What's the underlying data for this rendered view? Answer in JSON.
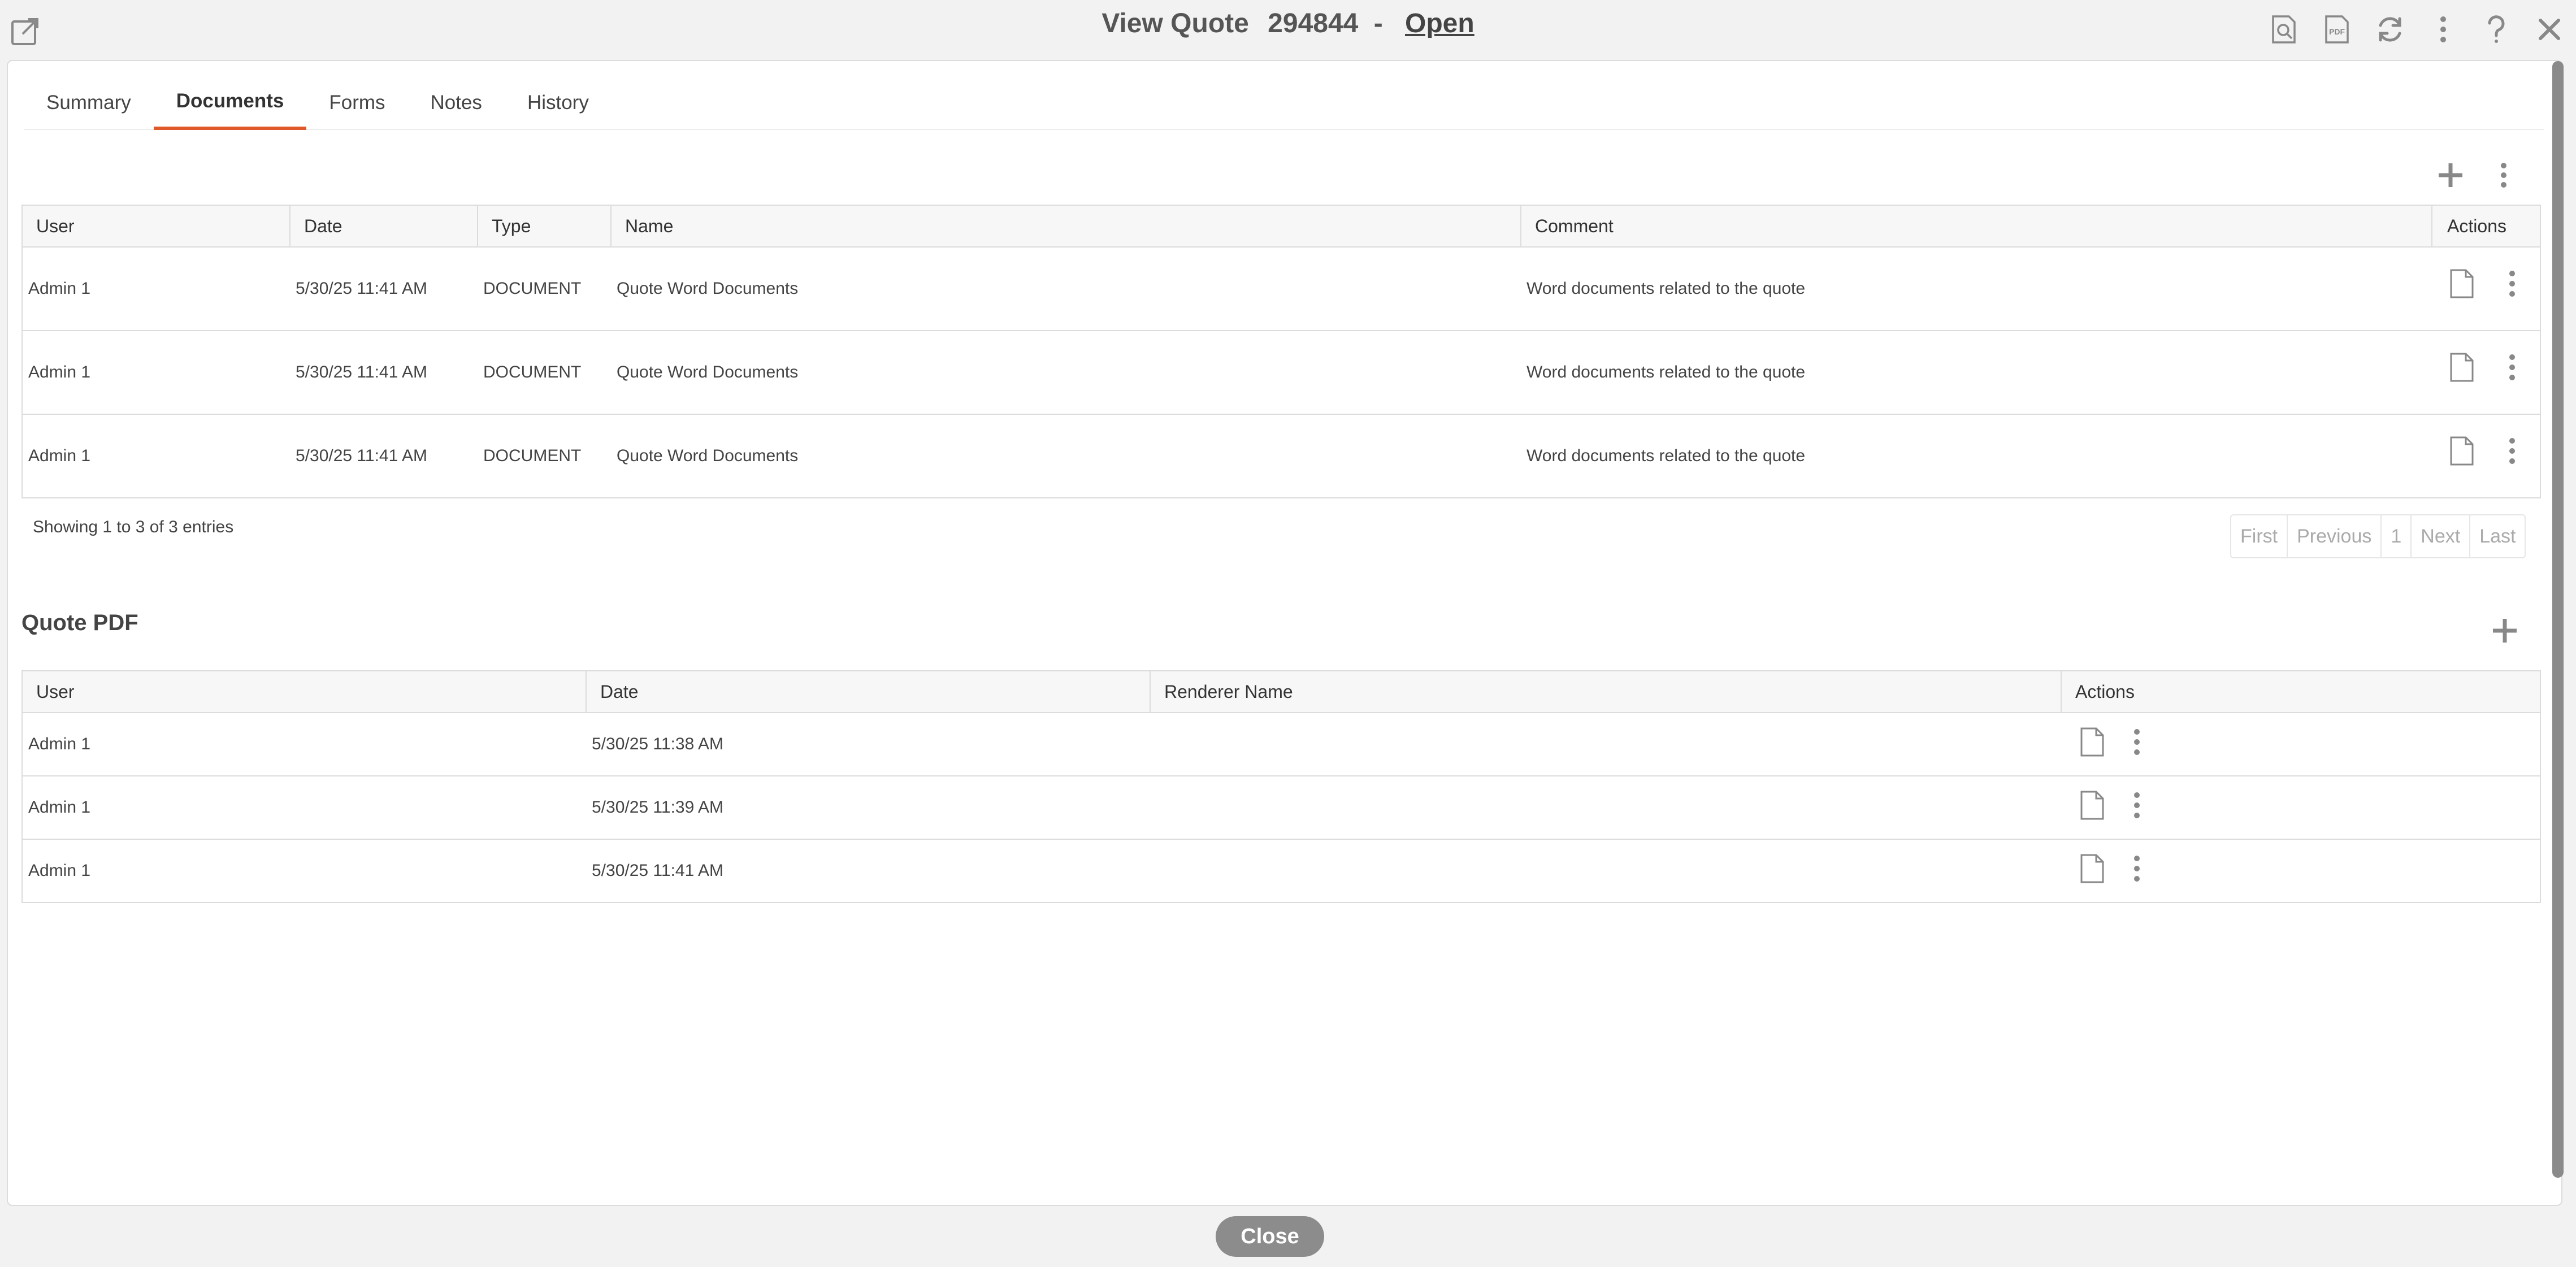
{
  "window": {
    "title_prefix": "View Quote",
    "quote_number": "294844",
    "separator": "-",
    "status": "Open"
  },
  "top_icons": [
    "preview-icon",
    "pdf-icon",
    "refresh-icon",
    "more-vertical-icon",
    "help-icon",
    "close-icon"
  ],
  "pdf_icon_text": "PDF",
  "tabs": [
    {
      "label": "Summary"
    },
    {
      "label": "Documents",
      "active": true
    },
    {
      "label": "Forms"
    },
    {
      "label": "Notes"
    },
    {
      "label": "History"
    }
  ],
  "documents_table": {
    "columns": [
      "User",
      "Date",
      "Type",
      "Name",
      "Comment",
      "Actions"
    ],
    "rows": [
      {
        "user": "Admin 1",
        "date": "5/30/25 11:41 AM",
        "type": "DOCUMENT",
        "name": "Quote Word Documents",
        "comment": "Word documents related to the quote"
      },
      {
        "user": "Admin 1",
        "date": "5/30/25 11:41 AM",
        "type": "DOCUMENT",
        "name": "Quote Word Documents",
        "comment": "Word documents related to the quote"
      },
      {
        "user": "Admin 1",
        "date": "5/30/25 11:41 AM",
        "type": "DOCUMENT",
        "name": "Quote Word Documents",
        "comment": "Word documents related to the quote"
      }
    ],
    "showing": "Showing 1 to 3 of 3 entries",
    "pager": [
      "First",
      "Previous",
      "1",
      "Next",
      "Last"
    ]
  },
  "quote_pdf": {
    "title": "Quote PDF",
    "columns": [
      "User",
      "Date",
      "Renderer Name",
      "Actions"
    ],
    "rows": [
      {
        "user": "Admin 1",
        "date": "5/30/25 11:38 AM",
        "renderer": ""
      },
      {
        "user": "Admin 1",
        "date": "5/30/25 11:39 AM",
        "renderer": ""
      },
      {
        "user": "Admin 1",
        "date": "5/30/25 11:41 AM",
        "renderer": ""
      }
    ]
  },
  "footer": {
    "close_label": "Close"
  },
  "colors": {
    "accent": "#e0592a",
    "icon": "#888888",
    "close_button": "#8c8c8c"
  }
}
